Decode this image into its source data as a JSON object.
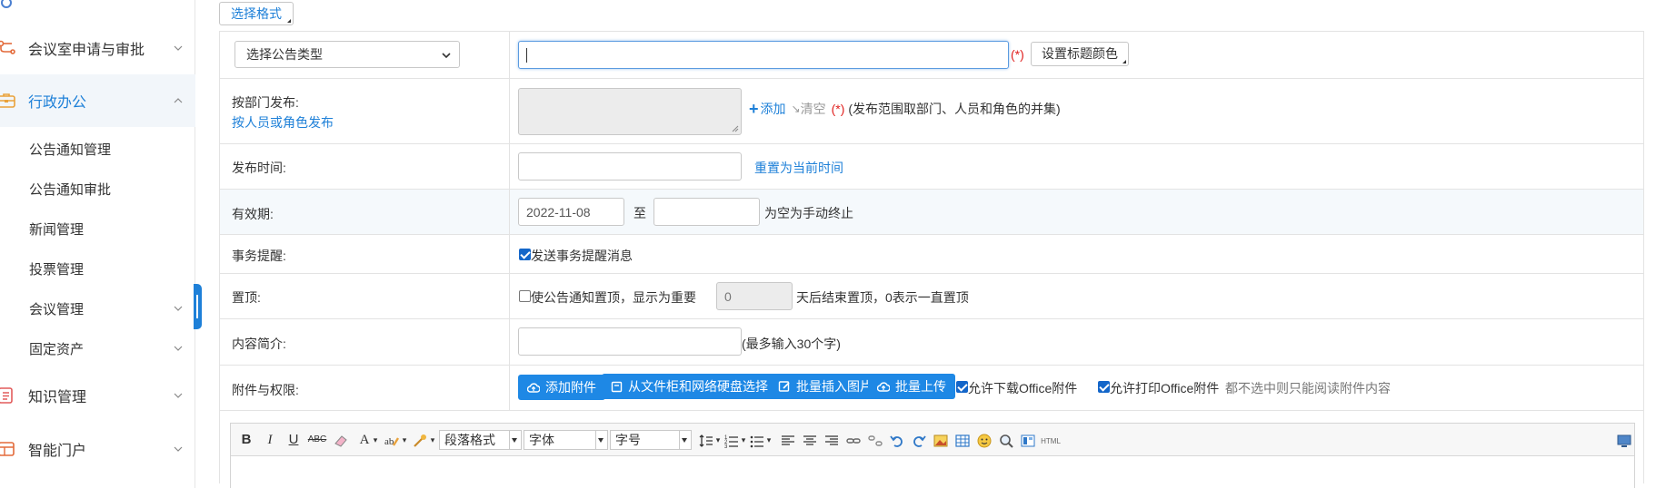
{
  "sidebar": {
    "items": [
      {
        "label": "会议室申请与审批",
        "icon": "meeting-flow-icon"
      },
      {
        "label": "行政办公",
        "icon": "briefcase-icon",
        "active": true
      },
      {
        "label": "公告通知管理"
      },
      {
        "label": "公告通知审批"
      },
      {
        "label": "新闻管理"
      },
      {
        "label": "投票管理"
      },
      {
        "label": "会议管理"
      },
      {
        "label": "固定资产"
      },
      {
        "label": "知识管理",
        "icon": "document-list-icon"
      },
      {
        "label": "智能门户",
        "icon": "portal-icon"
      }
    ]
  },
  "toolbar": {
    "format_button": "选择格式"
  },
  "form": {
    "type_select": "选择公告类型",
    "required_mark": "(*)",
    "title_color_button": "设置标题颜色",
    "dept_label": "按部门发布:",
    "dept_alt_link": "按人员或角色发布",
    "add_link": "添加",
    "clear_link": "清空",
    "dept_hint": "(发布范围取部门、人员和角色的并集)",
    "publish_time_label": "发布时间:",
    "reset_time_link": "重置为当前时间",
    "validity_label": "有效期:",
    "validity_start": "2022-11-08",
    "validity_to": "至",
    "validity_hint": "为空为手动终止",
    "reminder_label": "事务提醒:",
    "reminder_check": "发送事务提醒消息",
    "reminder_checked": true,
    "top_label": "置顶:",
    "top_check": "使公告通知置顶，显示为重要",
    "top_checked": false,
    "top_days": "0",
    "top_hint": "天后结束置顶，0表示一直置顶",
    "summary_label": "内容简介:",
    "summary_hint": "(最多输入30个字)",
    "attach_label": "附件与权限:",
    "btn_add_attach": "添加附件",
    "btn_from_cabinet": "从文件柜和网络硬盘选择附件",
    "btn_insert_images": "批量插入图片",
    "btn_batch_upload": "批量上传",
    "allow_download": "允许下载Office附件",
    "allow_download_checked": true,
    "allow_print": "允许打印Office附件",
    "allow_print_checked": true,
    "attach_hint": "都不选中则只能阅读附件内容"
  },
  "editor": {
    "bold": "B",
    "italic": "I",
    "underline": "U",
    "strike": "ABC",
    "font_color": "A",
    "paragraph_format": "段落格式",
    "font_family": "字体",
    "font_size": "字号",
    "html": "HTML"
  },
  "colors": {
    "accent": "#1e80d8",
    "button": "#1e88e5",
    "required": "#e0201e"
  }
}
